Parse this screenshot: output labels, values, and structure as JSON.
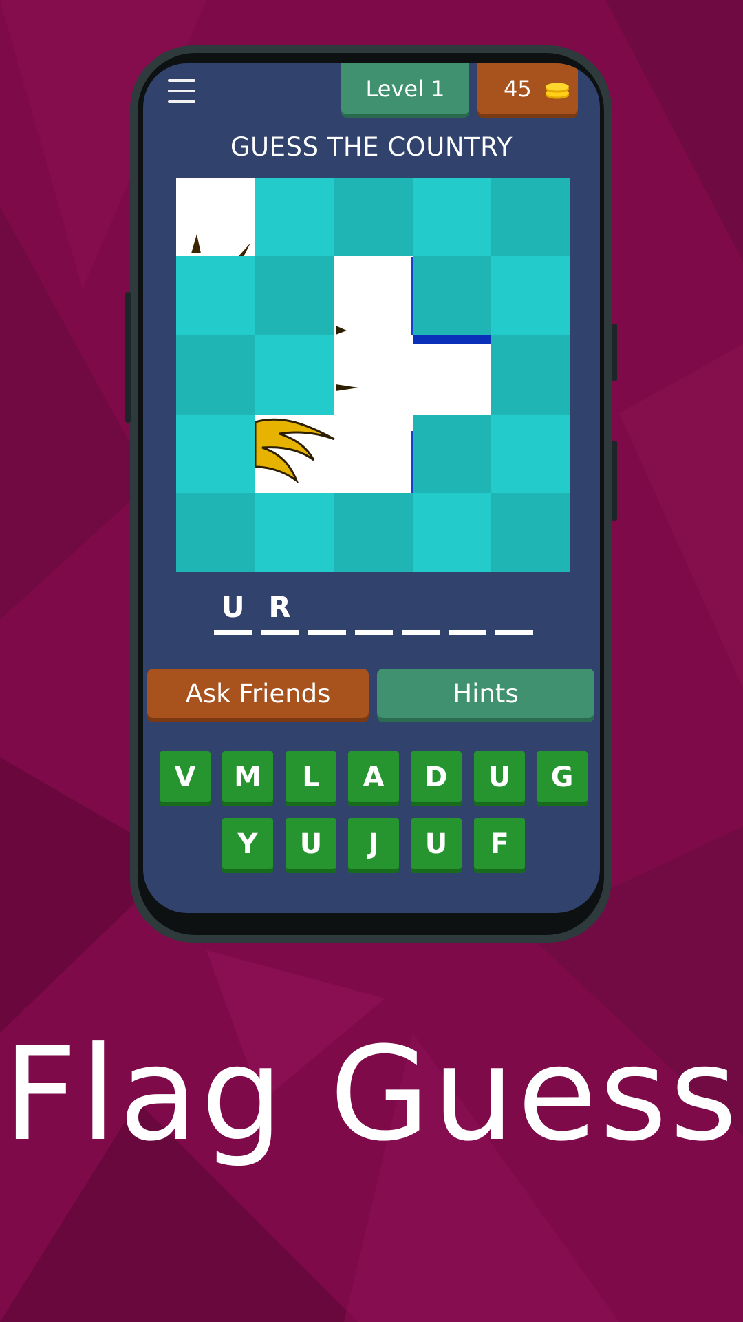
{
  "header": {
    "level_label": "Level 1",
    "coins": "45"
  },
  "title": "GUESS THE COUNTRY",
  "answer": {
    "slots": [
      "U",
      "R",
      "",
      "",
      "",
      "",
      ""
    ]
  },
  "actions": {
    "ask_friends": "Ask Friends",
    "hints": "Hints"
  },
  "letters": {
    "row1": [
      "V",
      "M",
      "L",
      "A",
      "D",
      "U",
      "G"
    ],
    "row2": [
      "Y",
      "U",
      "J",
      "U",
      "F"
    ]
  },
  "footer": {
    "app_name": "Flag Guess"
  },
  "colors": {
    "background": "#7e0a4a",
    "screen": "#31436c",
    "tile_light": "#24cbcb",
    "tile_dark": "#1fb5b5",
    "level_badge": "#409170",
    "coins_badge": "#a8521e",
    "key": "#27952f"
  },
  "icons": {
    "menu": "hamburger-icon",
    "coins": "coin-stack-icon"
  }
}
